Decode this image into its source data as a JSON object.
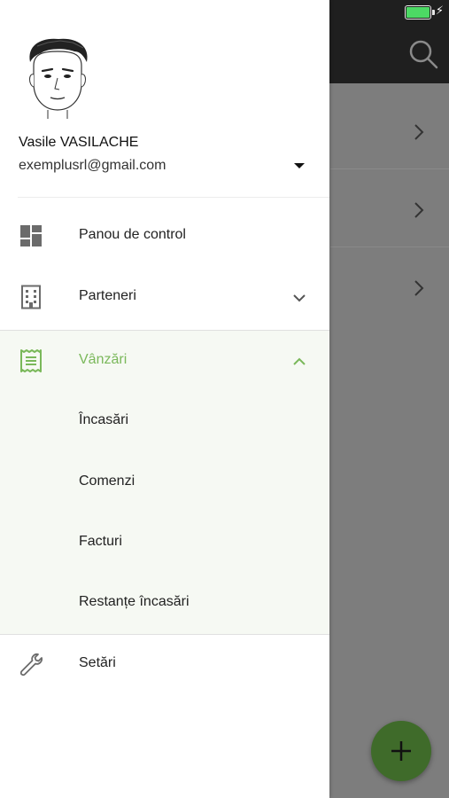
{
  "status_bar": {
    "battery_icon": "battery-charging-icon"
  },
  "app_bar": {
    "search_icon": "search-icon"
  },
  "fab": {
    "icon": "plus-icon",
    "color": "#3f6b2a"
  },
  "drawer": {
    "user": {
      "name": "Vasile VASILACHE",
      "email": "exemplusrl@gmail.com"
    },
    "items": [
      {
        "label": "Panou de control",
        "icon": "dashboard-icon"
      },
      {
        "label": "Parteneri",
        "icon": "building-icon",
        "expanded": false
      },
      {
        "label": "Vânzări",
        "icon": "receipt-icon",
        "expanded": true,
        "active": true,
        "children": [
          {
            "label": "Încasări"
          },
          {
            "label": "Comenzi"
          },
          {
            "label": "Facturi"
          },
          {
            "label": "Restanțe încasări"
          }
        ]
      },
      {
        "label": "Setări",
        "icon": "wrench-icon"
      }
    ],
    "accent_color": "#7ab85a"
  }
}
